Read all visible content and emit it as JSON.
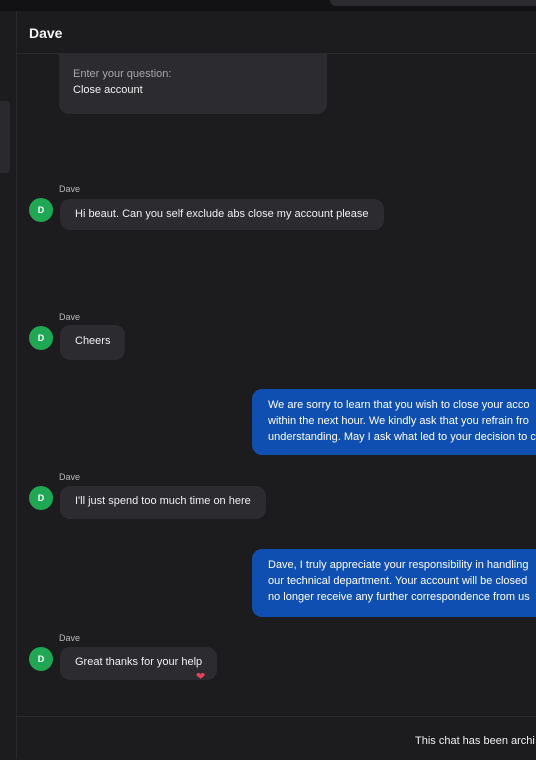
{
  "header": {
    "title": "Dave"
  },
  "intro_form": {
    "label": "Enter your question:",
    "value": "Close account"
  },
  "messages": [
    {
      "sender": "Dave",
      "avatar_initial": "D",
      "text": "Hi beaut. Can you self exclude abs close my account please"
    },
    {
      "sender": "Dave",
      "avatar_initial": "D",
      "text": "Cheers"
    },
    {
      "lines": [
        "We are sorry to learn that you wish to close your acco",
        "within the next hour. We kindly ask that you refrain fro",
        "understanding. May I ask what led to your decision to c"
      ]
    },
    {
      "sender": "Dave",
      "avatar_initial": "D",
      "text": "I'll just spend too much time on here"
    },
    {
      "lines": [
        "Dave, I truly appreciate your responsibility in handling",
        "our technical department. Your account will be closed",
        "no longer receive any further correspondence from us"
      ]
    },
    {
      "sender": "Dave",
      "avatar_initial": "D",
      "text": "Great thanks for your help",
      "reaction": "heart"
    }
  ],
  "footer": {
    "status_text": "This chat has been archi"
  },
  "colors": {
    "agent_bubble": "#0f4fb1",
    "avatar": "#1fa854",
    "reaction": "#e8415f"
  }
}
